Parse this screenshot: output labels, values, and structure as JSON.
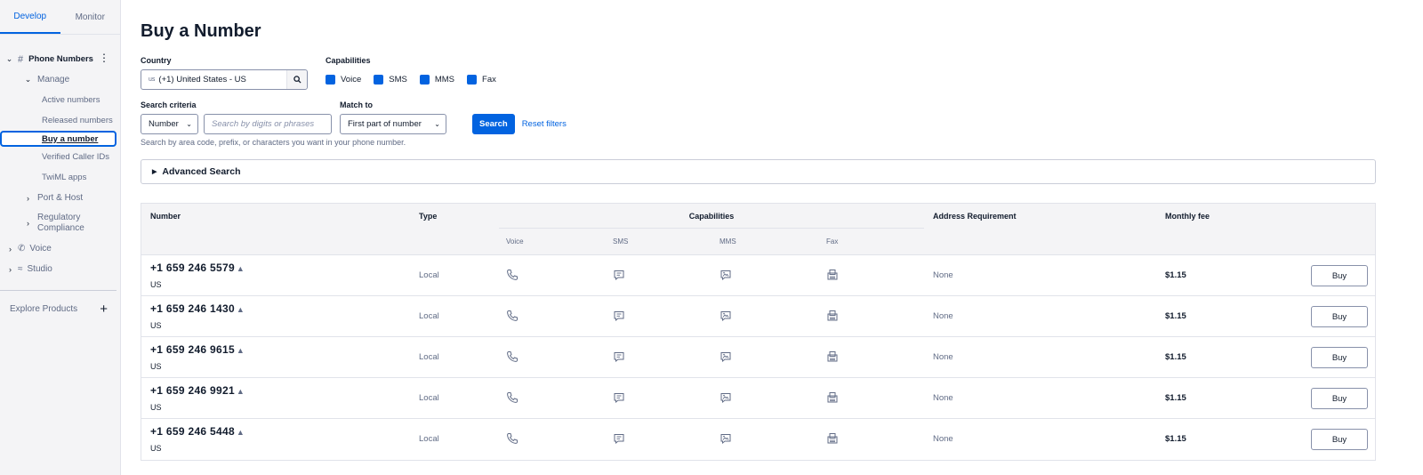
{
  "sidebar": {
    "tabs": [
      {
        "label": "Develop"
      },
      {
        "label": "Monitor"
      }
    ],
    "group": {
      "label": "Phone Numbers"
    },
    "manage": {
      "label": "Manage"
    },
    "leaves": [
      {
        "label": "Active numbers"
      },
      {
        "label": "Released numbers"
      },
      {
        "label": "Buy a number"
      },
      {
        "label": "Verified Caller IDs"
      },
      {
        "label": "TwiML apps"
      }
    ],
    "port_host": {
      "label": "Port & Host"
    },
    "regulatory": {
      "label": "Regulatory Compliance"
    },
    "voice": {
      "label": "Voice"
    },
    "studio": {
      "label": "Studio"
    },
    "explore": {
      "label": "Explore Products"
    }
  },
  "page": {
    "title": "Buy a Number"
  },
  "filters": {
    "country_label": "Country",
    "country_flag": "us",
    "country_value": "(+1) United States - US",
    "capabilities_label": "Capabilities",
    "capabilities": [
      {
        "label": "Voice"
      },
      {
        "label": "SMS"
      },
      {
        "label": "MMS"
      },
      {
        "label": "Fax"
      }
    ],
    "criteria_label": "Search criteria",
    "criteria_value": "Number",
    "search_placeholder": "Search by digits or phrases",
    "match_label": "Match to",
    "match_value": "First part of number",
    "search_button": "Search",
    "reset_link": "Reset filters",
    "hint": "Search by area code, prefix, or characters you want in your phone number."
  },
  "advanced": {
    "label": "Advanced Search"
  },
  "table": {
    "headers": {
      "number": "Number",
      "type": "Type",
      "capabilities": "Capabilities",
      "address": "Address Requirement",
      "fee": "Monthly fee",
      "voice": "Voice",
      "sms": "SMS",
      "mms": "MMS",
      "fax": "Fax"
    },
    "rows": [
      {
        "number": "+1 659 246 5579",
        "country": "US",
        "type": "Local",
        "address": "None",
        "fee": "$1.15",
        "buy": "Buy"
      },
      {
        "number": "+1 659 246 1430",
        "country": "US",
        "type": "Local",
        "address": "None",
        "fee": "$1.15",
        "buy": "Buy"
      },
      {
        "number": "+1 659 246 9615",
        "country": "US",
        "type": "Local",
        "address": "None",
        "fee": "$1.15",
        "buy": "Buy"
      },
      {
        "number": "+1 659 246 9921",
        "country": "US",
        "type": "Local",
        "address": "None",
        "fee": "$1.15",
        "buy": "Buy"
      },
      {
        "number": "+1 659 246 5448",
        "country": "US",
        "type": "Local",
        "address": "None",
        "fee": "$1.15",
        "buy": "Buy"
      }
    ]
  },
  "colors": {
    "accent": "#0263e0",
    "text": "#121c2d",
    "muted": "#606b85",
    "sidebar_bg": "#f4f4f6"
  }
}
